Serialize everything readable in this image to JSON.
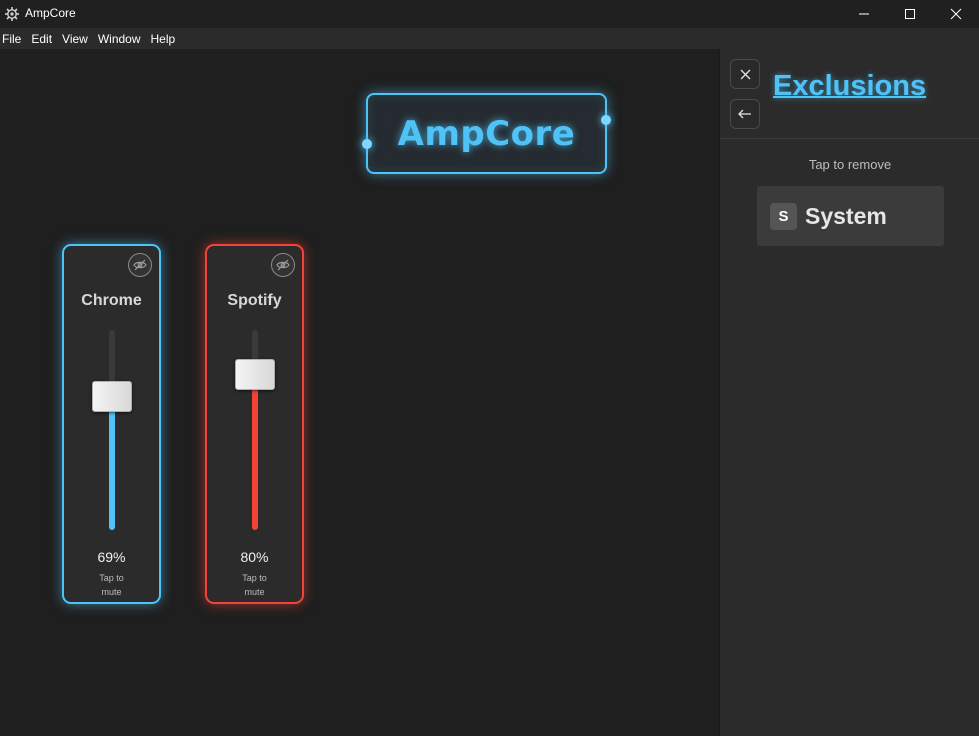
{
  "window": {
    "title": "AmpCore",
    "icon": "gear-icon"
  },
  "menu": [
    "File",
    "Edit",
    "View",
    "Window",
    "Help"
  ],
  "logo": {
    "text": "AmpCore"
  },
  "channels": [
    {
      "name": "Chrome",
      "volume_percent": 69,
      "volume_label": "69%",
      "hint_line1": "Tap to",
      "hint_line2": "mute",
      "accent": "#4fc3f7"
    },
    {
      "name": "Spotify",
      "volume_percent": 80,
      "volume_label": "80%",
      "hint_line1": "Tap to",
      "hint_line2": "mute",
      "accent": "#f44336"
    }
  ],
  "panel": {
    "title": "Exclusions",
    "close_icon": "close-icon",
    "back_icon": "arrow-left-icon",
    "hint": "Tap to remove",
    "items": [
      {
        "badge": "S",
        "label": "System"
      }
    ]
  },
  "colors": {
    "accent_blue": "#4fc3f7",
    "accent_red": "#f44336",
    "background": "#1f1f1f",
    "panel": "#2b2b2b"
  }
}
